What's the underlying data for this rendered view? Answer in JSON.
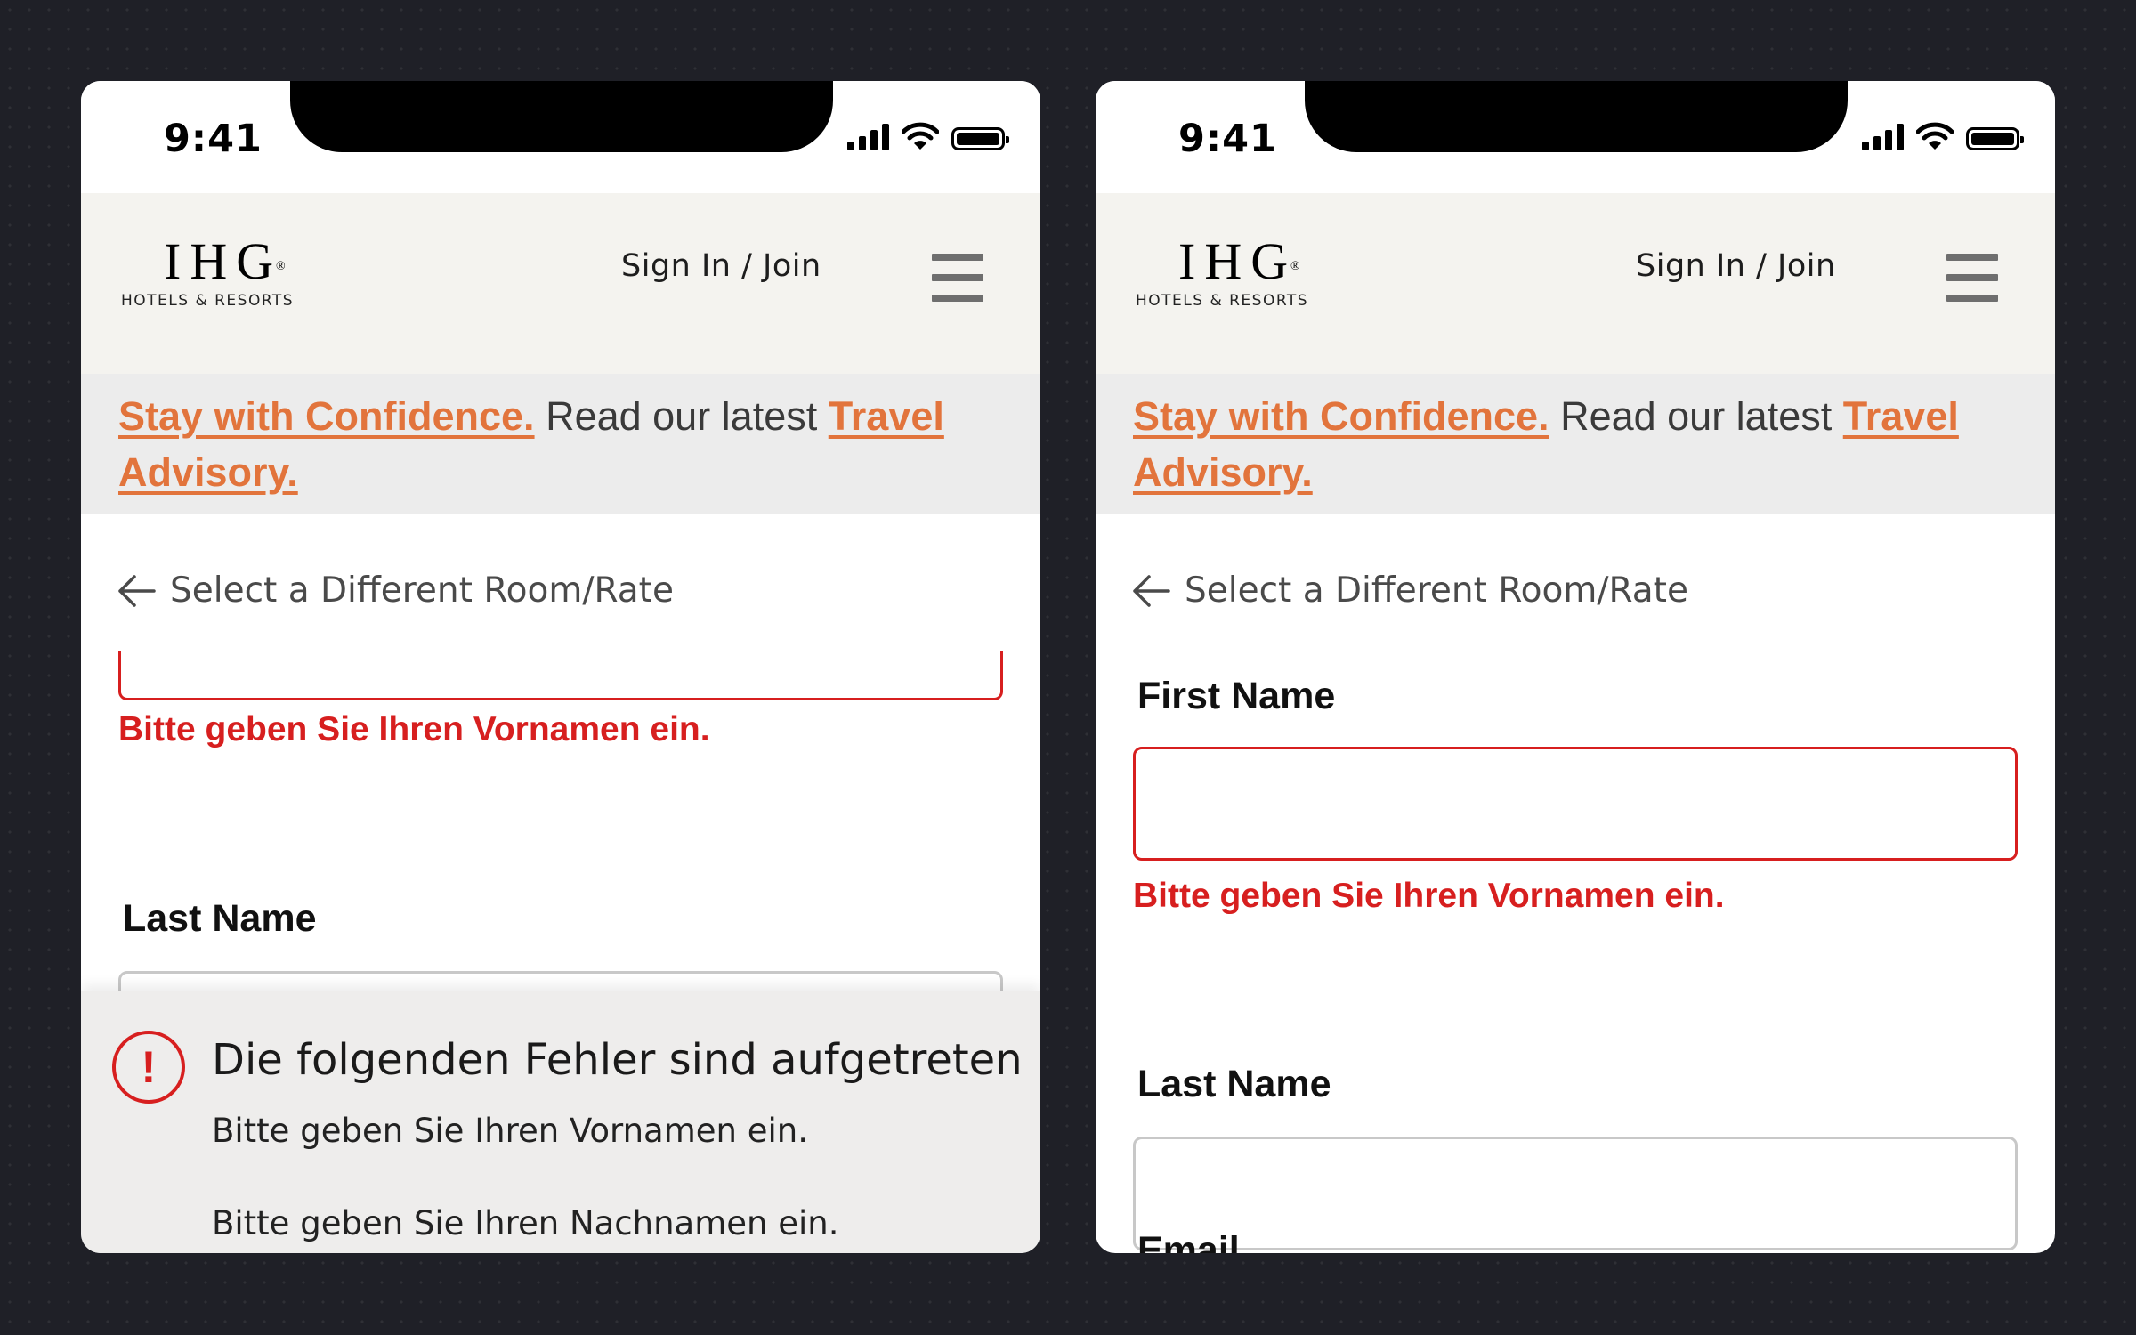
{
  "status_bar": {
    "time": "9:41"
  },
  "header": {
    "logo_mark": "IHG",
    "logo_registered": "®",
    "logo_sub": "HOTELS & RESORTS",
    "signin_label": "Sign In / Join"
  },
  "advisory": {
    "link1": "Stay with Confidence.",
    "text": " Read our latest ",
    "link2": "Travel Advisory."
  },
  "back_link": {
    "label": "Select a Different Room/Rate"
  },
  "form": {
    "first_name_label": "First Name",
    "first_name_error": "Bitte geben Sie Ihren Vornamen ein.",
    "last_name_label": "Last Name",
    "email_label": "Email"
  },
  "error_panel": {
    "title": "Die folgenden Fehler sind aufgetreten",
    "icon_glyph": "!",
    "messages": [
      "Bitte geben Sie Ihren Vornamen ein.",
      "Bitte geben Sie Ihren Nachnamen ein."
    ]
  },
  "colors": {
    "error": "#d71f1f",
    "link_orange": "#e2743c",
    "header_bg": "#f4f3ef",
    "advisory_bg": "#ececec"
  },
  "icons": [
    "cellular-signal-icon",
    "wifi-icon",
    "battery-icon",
    "menu-icon",
    "arrow-left-icon",
    "error-alert-icon"
  ]
}
